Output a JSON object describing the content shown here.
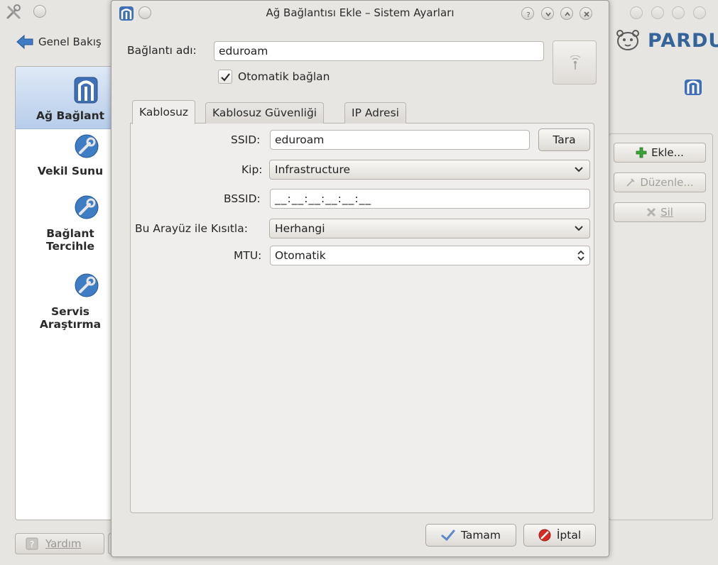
{
  "background_window": {
    "back_label": "Genel Bakış",
    "sidebar": {
      "items": [
        {
          "label": "Ağ Bağlant",
          "label2": ""
        },
        {
          "label": "Vekil Sunu",
          "label2": ""
        },
        {
          "label": "Bağlant",
          "label2": "Tercihle"
        },
        {
          "label": "Servis",
          "label2": "Araştırma"
        }
      ]
    },
    "help_label": "Yardım",
    "logo_text": "PARDUS",
    "actions": {
      "add_label": "Ekle...",
      "edit_label": "Düzenle...",
      "delete_label": "Sil"
    }
  },
  "dialog": {
    "title": "Ağ Bağlantısı Ekle – Sistem Ayarları",
    "connection_name_label": "Bağlantı adı:",
    "connection_name_value": "eduroam",
    "autoconnect_label": "Otomatik bağlan",
    "autoconnect_checked": true,
    "tabs": [
      {
        "label": "Kablosuz",
        "active": true
      },
      {
        "label": "Kablosuz Güvenliği",
        "active": false
      },
      {
        "label": "IP Adresi",
        "active": false
      }
    ],
    "wireless": {
      "ssid_label": "SSID:",
      "ssid_value": "eduroam",
      "scan_label": "Tara",
      "mode_label": "Kip:",
      "mode_value": "Infrastructure",
      "bssid_label": "BSSID:",
      "bssid_value": "__:__:__:__:__:__",
      "restrict_label": "Bu Arayüz ile Kısıtla:",
      "restrict_value": "Herhangi",
      "mtu_label": "MTU:",
      "mtu_value": "Otomatik"
    },
    "ok_label": "Tamam",
    "cancel_label": "İptal"
  },
  "colors": {
    "accent_blue": "#3e7cc4",
    "add_green": "#3aa636",
    "cancel_red": "#d62b22",
    "selection_blue": "#b7cdea"
  }
}
